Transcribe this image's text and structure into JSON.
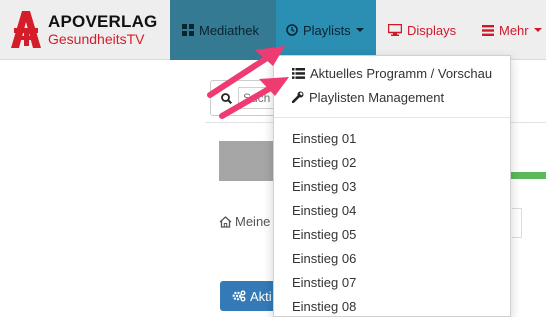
{
  "brand": {
    "title": "APOVERLAG",
    "subtitle": "GesundheitsTV"
  },
  "nav": {
    "mediathek": "Mediathek",
    "playlists": "Playlists",
    "displays": "Displays",
    "mehr": "Mehr"
  },
  "search": {
    "placeholder": "Such"
  },
  "breadcrumb": {
    "label": "Meine"
  },
  "action_button": {
    "label": "Akti"
  },
  "dropdown": {
    "header_items": [
      {
        "label": "Aktuelles Programm / Vorschau",
        "icon": "list-icon"
      },
      {
        "label": "Playlisten Management",
        "icon": "wrench-icon"
      }
    ],
    "playlists": [
      "Einstieg 01",
      "Einstieg 02",
      "Einstieg 03",
      "Einstieg 04",
      "Einstieg 05",
      "Einstieg 06",
      "Einstieg 07",
      "Einstieg 08"
    ]
  },
  "colors": {
    "nav_active": "#2b8eb3",
    "nav_mediathek": "#337a92",
    "nav_red": "#d0182b",
    "brand_red": "#d51d2a",
    "annotation_arrow": "#ee3b72",
    "primary_button": "#337ab7"
  }
}
